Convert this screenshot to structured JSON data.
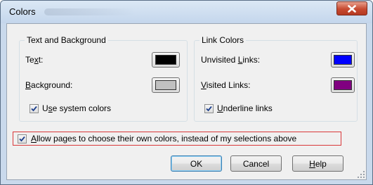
{
  "window": {
    "title": "Colors",
    "close_icon": "close-icon"
  },
  "text_background": {
    "legend": "Text and Background",
    "text_label": {
      "pre": "Te",
      "accel": "x",
      "post": "t:"
    },
    "background_label": {
      "pre": "",
      "accel": "B",
      "post": "ackground:"
    },
    "text_color": "#000000",
    "background_color": "#c0c0c0",
    "use_system_colors": {
      "pre": "U",
      "accel": "s",
      "post": "e system colors",
      "checked": true
    }
  },
  "link_colors": {
    "legend": "Link Colors",
    "unvisited_label": {
      "pre": "Unvisited ",
      "accel": "L",
      "post": "inks:"
    },
    "visited_label": {
      "pre": "",
      "accel": "V",
      "post": "isited Links:"
    },
    "unvisited_color": "#0000ff",
    "visited_color": "#800080",
    "underline_links": {
      "pre": "",
      "accel": "U",
      "post": "nderline links",
      "checked": true
    }
  },
  "allow_pages": {
    "pre": "",
    "accel": "A",
    "post": "llow pages to choose their own colors, instead of my selections above",
    "checked": true,
    "highlight_color": "#d9383a"
  },
  "buttons": {
    "ok": "OK",
    "cancel": "Cancel",
    "help": {
      "pre": "",
      "accel": "H",
      "post": "elp"
    }
  }
}
